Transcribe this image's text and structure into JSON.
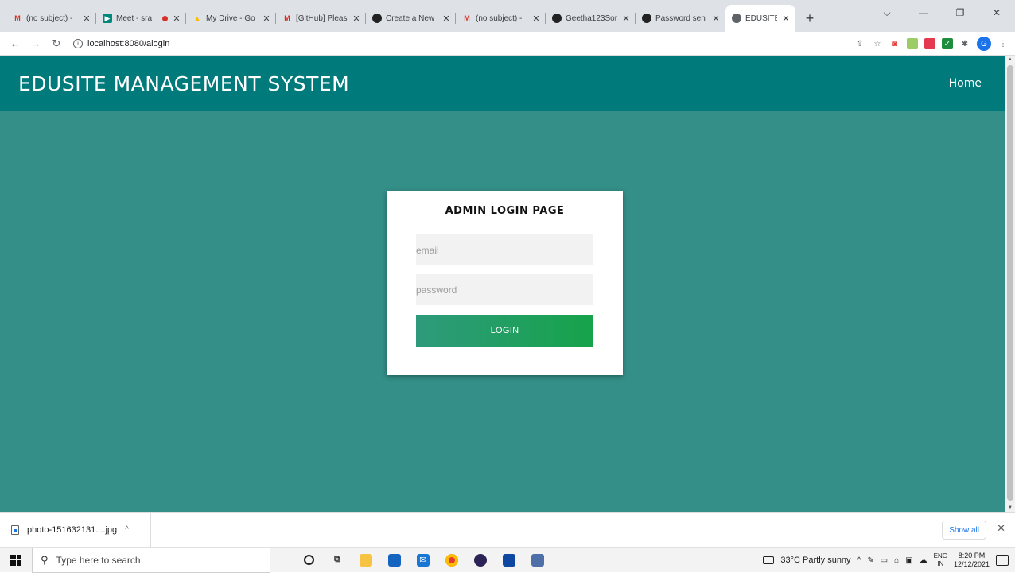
{
  "browser": {
    "tabs": [
      {
        "title": "(no subject) -",
        "icon": "gmail-icon"
      },
      {
        "title": "Meet - sra",
        "icon": "meet-icon"
      },
      {
        "title": "My Drive - Go",
        "icon": "drive-icon"
      },
      {
        "title": "[GitHub] Pleas",
        "icon": "gmail-icon"
      },
      {
        "title": "Create a New",
        "icon": "github-icon"
      },
      {
        "title": "(no subject) -",
        "icon": "gmail-icon"
      },
      {
        "title": "Geetha123Sor",
        "icon": "github-icon"
      },
      {
        "title": "Password sen",
        "icon": "github-icon"
      },
      {
        "title": "EDUSITE",
        "icon": "globe-icon",
        "active": true
      }
    ],
    "url": "localhost:8080/alogin",
    "profile_initial": "G"
  },
  "site": {
    "title": "EDUSITE MANAGEMENT SYSTEM",
    "nav_home": "Home"
  },
  "login": {
    "heading": "ADMIN LOGIN PAGE",
    "email_placeholder": "email",
    "password_placeholder": "password",
    "button_label": "LOGIN"
  },
  "downloads": {
    "filename": "photo-151632131....jpg",
    "show_all": "Show all"
  },
  "taskbar": {
    "search_placeholder": "Type here to search",
    "weather": "33°C  Partly sunny",
    "lang_top": "ENG",
    "lang_bottom": "IN",
    "time": "8:20 PM",
    "date": "12/12/2021"
  },
  "colors": {
    "header": "#007a7a",
    "page_bg": "#348f88",
    "button_start": "#2e9a7c",
    "button_end": "#16a34a"
  }
}
